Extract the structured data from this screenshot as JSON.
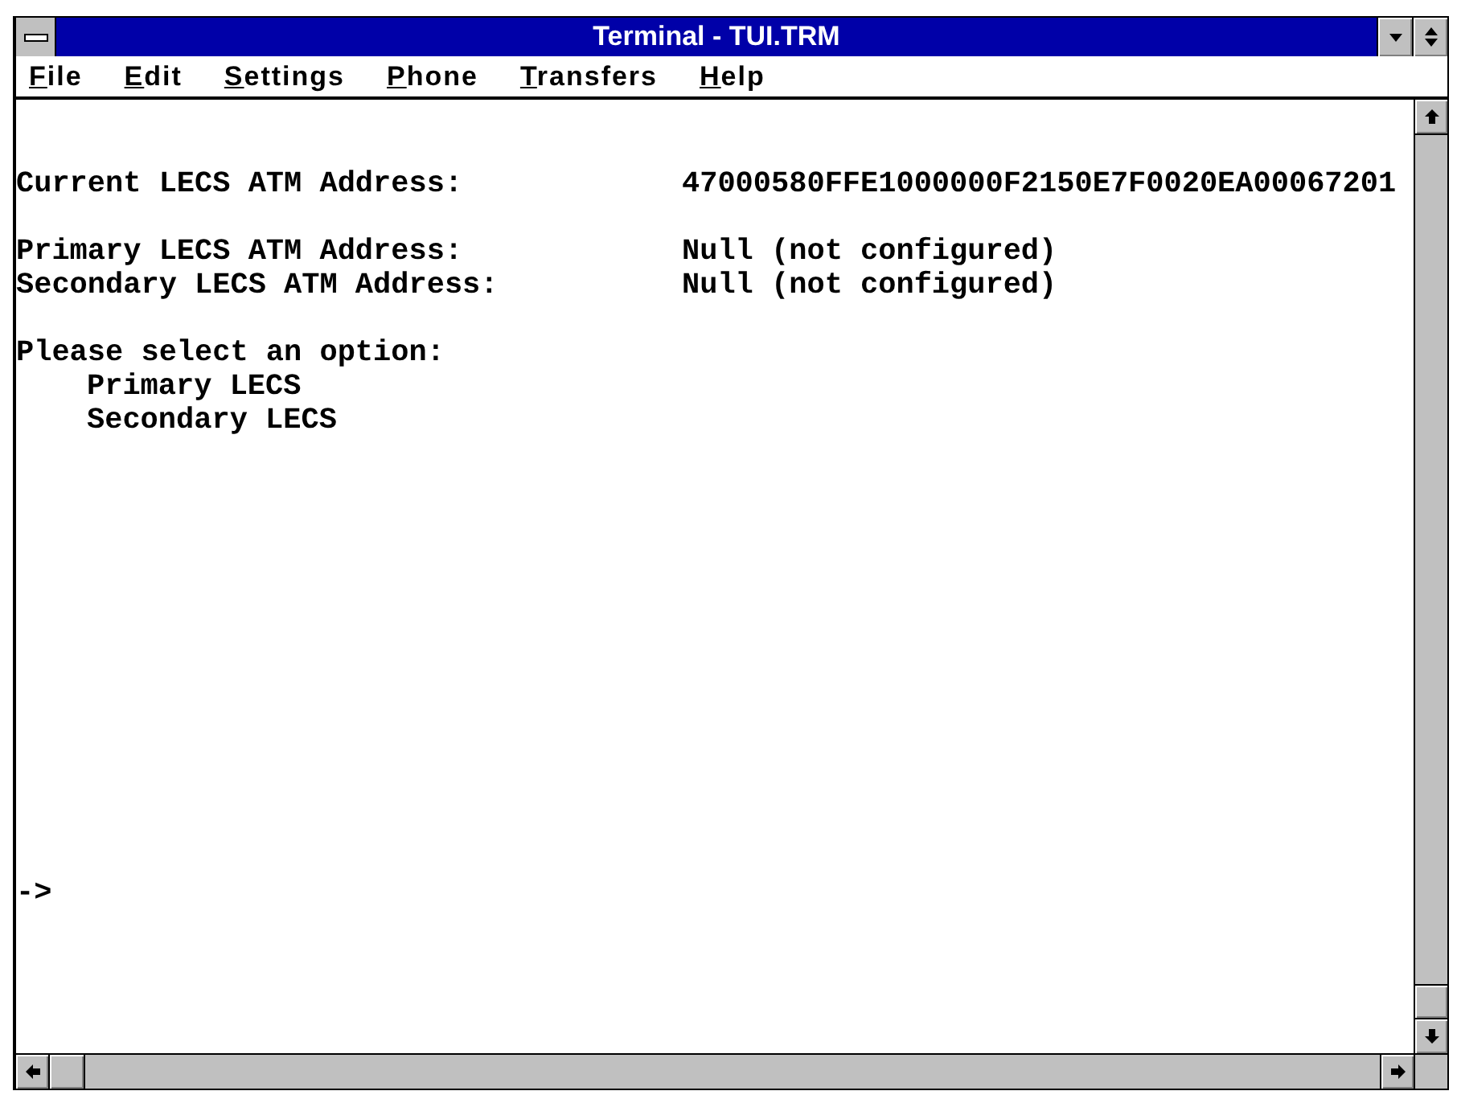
{
  "window": {
    "title": "Terminal - TUI.TRM"
  },
  "menu_bar": {
    "items": [
      "File",
      "Edit",
      "Settings",
      "Phone",
      "Transfers",
      "Help"
    ]
  },
  "terminal": {
    "sections": [
      {
        "kind": "fields",
        "rows": [
          {
            "label": "Current LECS ATM Address:",
            "value": "47000580FFE1000000F2150E7F0020EA00067201"
          }
        ]
      },
      {
        "kind": "fields",
        "rows": [
          {
            "label": "Primary LECS ATM Address:",
            "value": "Null (not configured)"
          },
          {
            "label": "Secondary LECS ATM Address:",
            "value": "Null (not configured)"
          }
        ]
      },
      {
        "kind": "menu",
        "heading": "Please select an option:",
        "options": [
          "Primary LECS",
          "Secondary LECS"
        ]
      }
    ],
    "prompt": "->"
  }
}
